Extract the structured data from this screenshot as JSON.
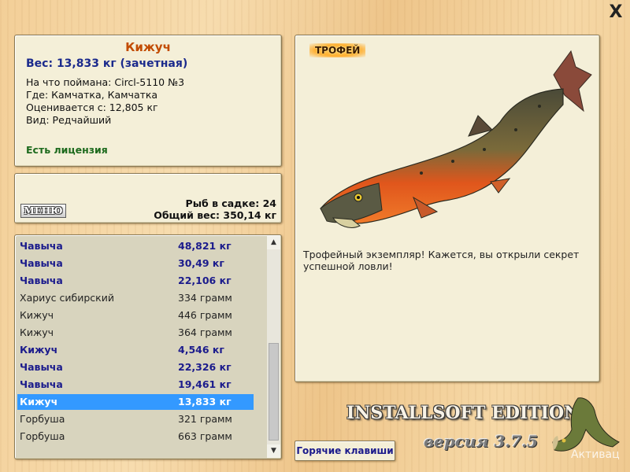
{
  "info": {
    "fish_name": "Кижуч",
    "weight_line": "Вес: 13,833 кг (зачетная)",
    "caught_with": "На что поймана: Circl-5110 №3",
    "where": "Где: Камчатка, Камчатка",
    "valued_from": "Оценивается с: 12,805 кг",
    "kind": "Вид: Редчайший",
    "license": "Есть лицензия"
  },
  "stats": {
    "menu_label": "МЕНЮ",
    "fish_in_keepnet": "Рыб в садке: 24",
    "total_weight": "Общий вес: 350,14 кг"
  },
  "catch_list": [
    {
      "name": "Чавыча",
      "weight": "48,821 кг",
      "bold": true,
      "selected": false
    },
    {
      "name": "Чавыча",
      "weight": "30,49 кг",
      "bold": true,
      "selected": false
    },
    {
      "name": "Чавыча",
      "weight": "22,106 кг",
      "bold": true,
      "selected": false
    },
    {
      "name": "Хариус сибирский",
      "weight": "334 грамм",
      "bold": false,
      "selected": false
    },
    {
      "name": "Кижуч",
      "weight": "446 грамм",
      "bold": false,
      "selected": false
    },
    {
      "name": "Кижуч",
      "weight": "364 грамм",
      "bold": false,
      "selected": false
    },
    {
      "name": "Кижуч",
      "weight": "4,546 кг",
      "bold": true,
      "selected": false
    },
    {
      "name": "Чавыча",
      "weight": "22,326 кг",
      "bold": true,
      "selected": false
    },
    {
      "name": "Чавыча",
      "weight": "19,461 кг",
      "bold": true,
      "selected": false
    },
    {
      "name": "Кижуч",
      "weight": "13,833 кг",
      "bold": true,
      "selected": true
    },
    {
      "name": "Горбуша",
      "weight": "321 грамм",
      "bold": false,
      "selected": false
    },
    {
      "name": "Горбуша",
      "weight": "663 грамм",
      "bold": false,
      "selected": false
    }
  ],
  "trophy": {
    "badge": "ТРОФЕЙ",
    "description": "Трофейный экземпляр! Кажется, вы открыли секрет успешной ловли!"
  },
  "footer": {
    "hotkeys_label": "Горячие клавиши",
    "edition": "INSTALLSOFT EDITION",
    "version": "версия 3.7.5",
    "activation_text": "Активац"
  },
  "window": {
    "close_glyph": "X"
  },
  "icons": {
    "close": "close-icon",
    "scroll_up": "chevron-up-icon",
    "scroll_down": "chevron-down-icon"
  },
  "colors": {
    "accent_orange": "#c24b00",
    "bold_blue": "#1b1b8c",
    "license_green": "#1d6a1d",
    "selection": "#3399ff",
    "panel": "#f4efd8"
  }
}
